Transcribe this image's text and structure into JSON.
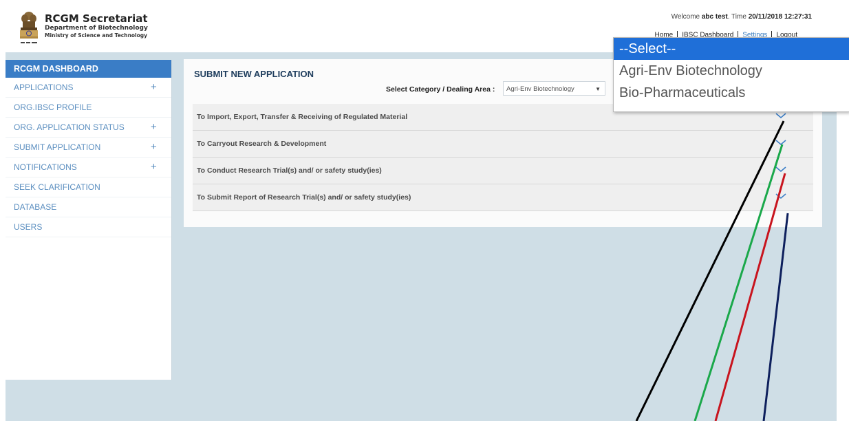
{
  "header": {
    "title": "RCGM Secretariat",
    "department": "Department of Biotechnology",
    "ministry": "Ministry of Science and Technology",
    "welcome_prefix": "Welcome",
    "user": "abc test",
    "time_label": ". Time",
    "time_value": "20/11/2018 12:27:31",
    "nav": [
      "Home",
      "IBSC Dashboard",
      "Settings",
      "Logout"
    ]
  },
  "sidebar": {
    "heading": "RCGM DASHBOARD",
    "items": [
      {
        "label": "APPLICATIONS",
        "expand": "+"
      },
      {
        "label": "ORG.IBSC PROFILE",
        "expand": ""
      },
      {
        "label": "ORG. APPLICATION STATUS",
        "expand": "+"
      },
      {
        "label": "SUBMIT APPLICATION",
        "expand": "+"
      },
      {
        "label": "NOTIFICATIONS",
        "expand": "+"
      },
      {
        "label": "SEEK CLARIFICATION",
        "expand": ""
      },
      {
        "label": "DATABASE",
        "expand": ""
      },
      {
        "label": "USERS",
        "expand": ""
      }
    ]
  },
  "main": {
    "title": "SUBMIT NEW APPLICATION",
    "category_label": "Select Category / Dealing Area :",
    "category_value": "Agri-Env Biotechnology",
    "sections": [
      "To Import, Export, Transfer & Receiving of Regulated Material",
      "To Carryout Research & Development",
      "To Conduct Research Trial(s) and/ or safety study(ies)",
      "To Submit Report of Research Trial(s) and/ or safety study(ies)"
    ]
  },
  "dropdown": {
    "options": [
      "--Select--",
      "Agri-Env Biotechnology",
      "Bio-Pharmaceuticals"
    ],
    "selected_index": 0
  },
  "colors": {
    "accent": "#3a7dc6",
    "sidebar_link": "#5c8fc0",
    "content_bg": "#cfdee6",
    "annotation_lines": [
      "#000000",
      "#1aa84a",
      "#c8141e",
      "#0d1f5c"
    ]
  }
}
